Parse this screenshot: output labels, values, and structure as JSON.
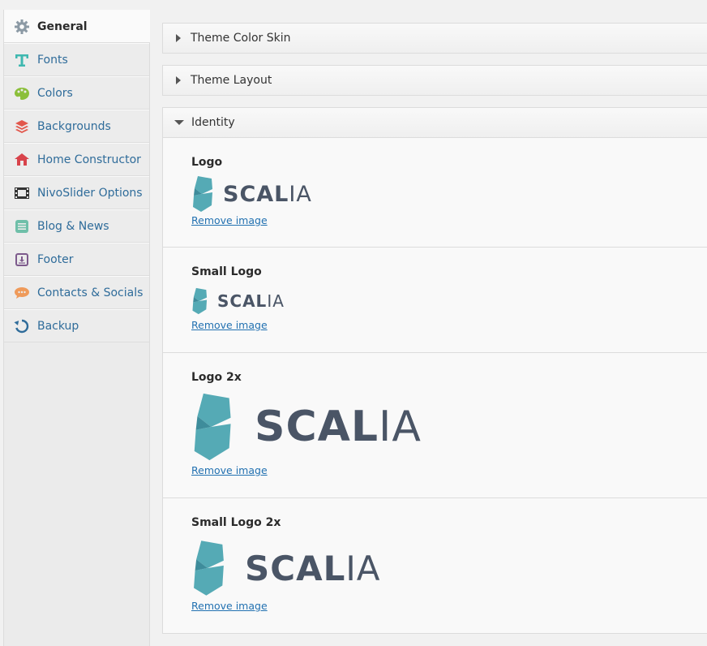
{
  "sidebar": {
    "items": [
      {
        "label": "General",
        "icon": "gear-icon",
        "color": "#8c9aa5",
        "active": true
      },
      {
        "label": "Fonts",
        "icon": "font-icon",
        "color": "#3fb8b0"
      },
      {
        "label": "Colors",
        "icon": "palette-icon",
        "color": "#8bbf3a"
      },
      {
        "label": "Backgrounds",
        "icon": "layers-icon",
        "color": "#e2574c"
      },
      {
        "label": "Home Constructor",
        "icon": "home-icon",
        "color": "#d8434b"
      },
      {
        "label": "NivoSlider Options",
        "icon": "filmstrip-icon",
        "color": "#333333"
      },
      {
        "label": "Blog & News",
        "icon": "list-icon",
        "color": "#6fbfa9"
      },
      {
        "label": "Footer",
        "icon": "download-box-icon",
        "color": "#7d5a8c"
      },
      {
        "label": "Contacts & Socials",
        "icon": "chat-bubble-icon",
        "color": "#ef9a5a"
      },
      {
        "label": "Backup",
        "icon": "refresh-icon",
        "color": "#2f6c9a"
      }
    ]
  },
  "sections": {
    "color_skin": "Theme Color Skin",
    "layout": "Theme Layout",
    "identity": "Identity"
  },
  "identity": {
    "remove_label": "Remove image",
    "logo_text_bold": "SCAL",
    "logo_text_light": "IA",
    "fields": [
      {
        "label": "Logo"
      },
      {
        "label": "Small Logo"
      },
      {
        "label": "Logo 2x"
      },
      {
        "label": "Small Logo 2x"
      }
    ]
  },
  "colors": {
    "logo_teal": "#55aab5",
    "logo_dark": "#4a5566",
    "link": "#2271b1"
  }
}
